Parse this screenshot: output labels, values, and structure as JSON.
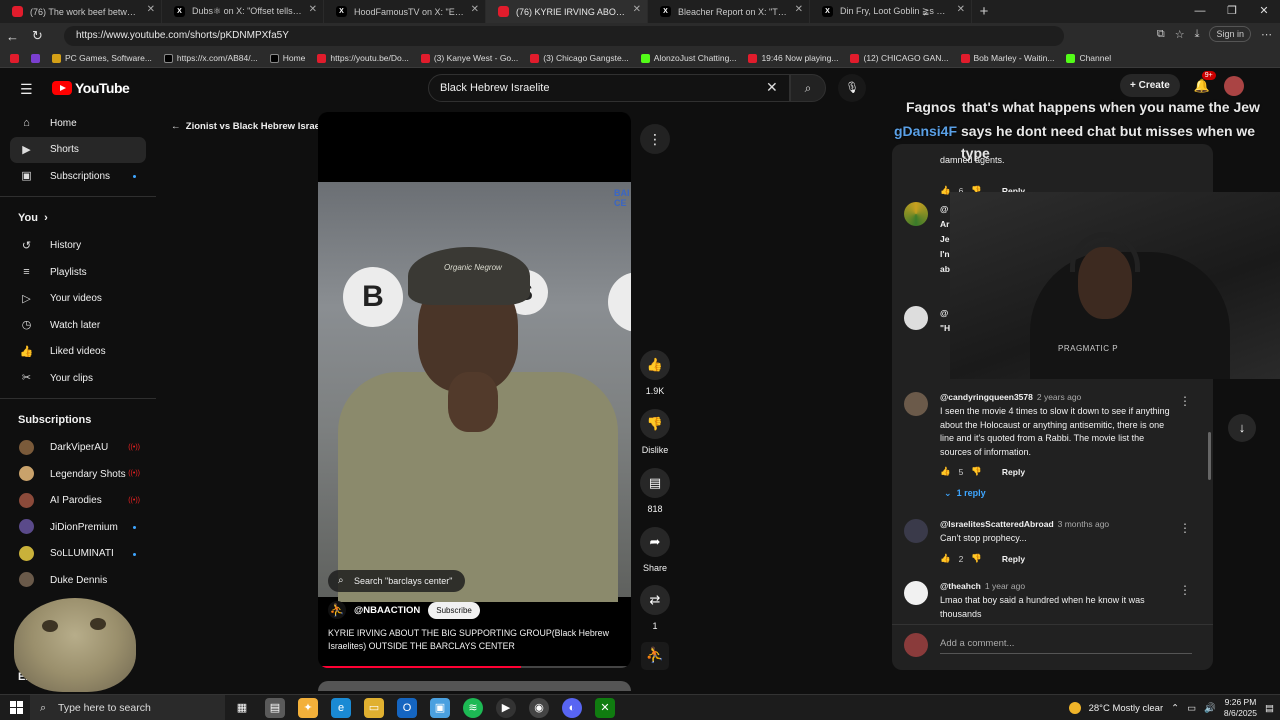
{
  "browser": {
    "tabs": [
      {
        "label": "(76) The work beef between Shaq",
        "icon": "yt"
      },
      {
        "label": "Dubs⚛ on X: \"Offset tells Joe Bud",
        "icon": "x"
      },
      {
        "label": "HoodFamousTV on X: \"Even the",
        "icon": "x"
      },
      {
        "label": "(76) KYRIE IRVING ABOUT TH",
        "icon": "yt"
      },
      {
        "label": "Bleacher Report on X: \"The NFL c",
        "icon": "x"
      },
      {
        "label": "Din Fry, Loot Goblin ≩s on X: \"If y",
        "icon": "x"
      }
    ],
    "url": "https://www.youtube.com/shorts/pKDNMPXfa5Y",
    "signin_label": "Sign in",
    "bookmarks": [
      "PC Games, Software...",
      "https://x.com/AB84/...",
      "Home",
      "https://youtu.be/Do...",
      "(3) Kanye West - Go...",
      "(3) Chicago Gangste...",
      "AlonzoJust Chatting...",
      "19:46 Now playing...",
      "(12) CHICAGO GAN...",
      "Bob Marley - Waitin...",
      "Channel"
    ]
  },
  "youtube": {
    "logo_text": "YouTube",
    "search_value": "Black Hebrew Israelite",
    "create_label": "Create",
    "notif_badge": "9+",
    "sidebar": {
      "main": [
        "Home",
        "Shorts",
        "Subscriptions"
      ],
      "you_header": "You",
      "you_items": [
        "History",
        "Playlists",
        "Your videos",
        "Watch later",
        "Liked videos",
        "Your clips"
      ],
      "subs_header": "Subscriptions",
      "subs": [
        "DarkViperAU",
        "Legendary Shots",
        "AI Parodies",
        "JiDionPremium",
        "SoLLUMINATI",
        "Duke Dennis"
      ],
      "explore_label": "Exp"
    },
    "short": {
      "back_title": "Zionist vs Black Hebrew Israelite",
      "search_pill": "Search \"barclays center\"",
      "channel": "@NBAACTION",
      "subscribe_label": "Subscribe",
      "title": "KYRIE IRVING ABOUT THE BIG SUPPORTING GROUP(Black Hebrew Israelites) OUTSIDE THE BARCLAYS CENTER",
      "progress_fraction": 0.65,
      "likes": "1.9K",
      "dislike_label": "Dislike",
      "comments_count": "818",
      "share_label": "Share",
      "remix_count": "1",
      "bg_text": "BAI CE",
      "cap_text": "Organic Negrow"
    },
    "comments": {
      "top_fragment": "damned agents.",
      "top_likes": "6",
      "reply_label": "Reply",
      "items": [
        {
          "handle": "@candyringqueen3578",
          "age": "2 years ago",
          "text": "I seen the movie 4 times to slow it down to see if anything about the Holocaust or anything antisemitic, there is one line and it's quoted from a Rabbi.  The movie list the sources of information.",
          "likes": "5",
          "replies": "1 reply"
        },
        {
          "handle": "@IsraelitesScatteredAbroad",
          "age": "3 months ago",
          "text": "Can't stop prophecy...",
          "likes": "2"
        },
        {
          "handle": "@theahch",
          "age": "1 year ago",
          "text": "Lmao that boy said a hundred when he know it was thousands"
        }
      ],
      "partial_lines": [
        "@",
        "Ar",
        "Je",
        "I'n",
        "ab",
        "@",
        "\"H"
      ],
      "add_placeholder": "Add a comment..."
    }
  },
  "stream_overlay": {
    "chat": [
      {
        "user": "Fagnos",
        "message": "that's what happens when you name the Jew"
      },
      {
        "user": "gDansi4F",
        "message": "says he dont need chat but misses when we type"
      }
    ],
    "webcam_text": "PRAGMATIC P"
  },
  "taskbar": {
    "search_placeholder": "Type here to search",
    "weather": "28°C  Mostly clear",
    "time": "9:26 PM",
    "date": "8/6/2025"
  }
}
